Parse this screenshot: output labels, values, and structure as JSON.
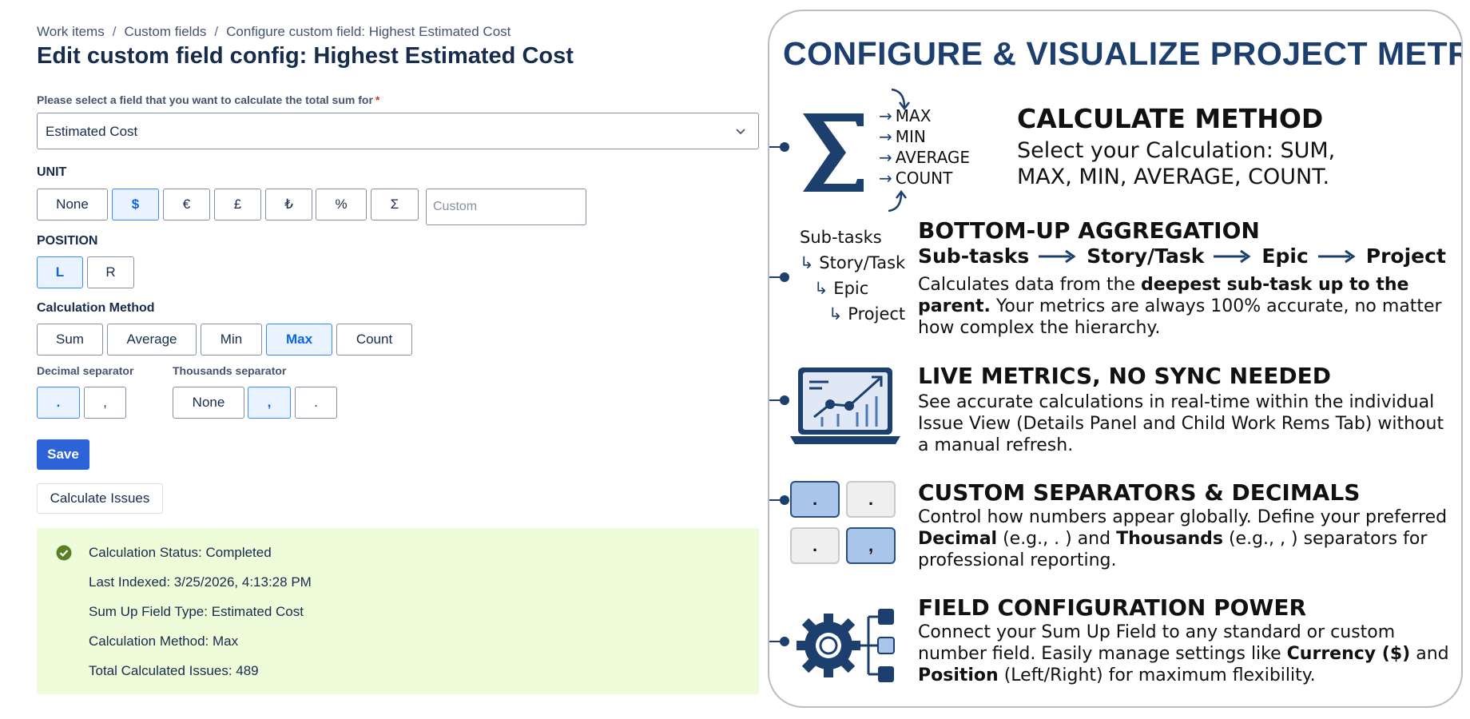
{
  "breadcrumb": [
    "Work items",
    "Custom fields",
    "Configure custom field: Highest Estimated Cost"
  ],
  "breadcrumb_separator": "/",
  "page_title": "Edit custom field config: Highest Estimated Cost",
  "field_select": {
    "label": "Please select a field that you want to calculate the total sum for",
    "required_mark": "*",
    "value": "Estimated Cost"
  },
  "unit": {
    "label": "UNIT",
    "options": [
      "None",
      "$",
      "€",
      "£",
      "₺",
      "%",
      "Σ"
    ],
    "selected": "$",
    "custom_placeholder": "Custom"
  },
  "position": {
    "label": "POSITION",
    "options": [
      "L",
      "R"
    ],
    "selected": "L"
  },
  "calculation_method": {
    "label": "Calculation Method",
    "options": [
      "Sum",
      "Average",
      "Min",
      "Max",
      "Count"
    ],
    "selected": "Max"
  },
  "decimal_separator": {
    "label": "Decimal separator",
    "options": [
      ".",
      ","
    ],
    "selected": "."
  },
  "thousands_separator": {
    "label": "Thousands separator",
    "options": [
      "None",
      ",",
      "."
    ],
    "selected": ","
  },
  "save_label": "Save",
  "calculate_label": "Calculate Issues",
  "status": {
    "lines": [
      "Calculation Status: Completed",
      "Last Indexed: 3/25/2026, 4:13:28 PM",
      "Sum Up Field Type: Estimated Cost",
      "Calculation Method: Max",
      "Total Calculated Issues: 489"
    ],
    "color": "#effcd9",
    "icon": "check-circle-icon"
  },
  "infographic": {
    "title": "CONFIGURE & VISUALIZE PROJECT METRICS",
    "calc_icon_items": [
      "MAX",
      "MIN",
      "AVERAGE",
      "COUNT"
    ],
    "sections": [
      {
        "heading": "CALCULATE METHOD",
        "text1": "Select your Calculation: SUM,",
        "text2": "MAX, MIN, AVERAGE, COUNT."
      },
      {
        "heading": "BOTTOM-UP AGGREGATION",
        "flow": [
          "Sub-tasks",
          "Story/Task",
          "Epic",
          "Project"
        ],
        "tree": [
          "Sub-tasks",
          "Story/Task",
          "Epic",
          "Project"
        ],
        "text_a": "Calculates data from the ",
        "text_b": "deepest sub-task up to the parent.",
        "text_c": "Your metrics are always 100% accurate, no matter how complex the hierarchy."
      },
      {
        "heading": "LIVE METRICS, NO SYNC NEEDED",
        "text": "See accurate calculations in real-time within the individual Issue View (Details Panel and Child Work Rems Tab) without a manual refresh."
      },
      {
        "heading": "CUSTOM SEPARATORS & DECIMALS",
        "boxes": [
          ".",
          ".",
          ".",
          ","
        ],
        "text_a": "Control how numbers appear globally. Define your preferred ",
        "text_b": "Decimal",
        "text_c": " (e.g., . ) and ",
        "text_d": "Thousands",
        "text_e": " (e.g., , ) separators for professional reporting."
      },
      {
        "heading": "FIELD CONFIGURATION POWER",
        "text_a": "Connect your Sum Up Field to any standard or custom number field. Easily manage settings like ",
        "text_b": "Currency ($)",
        "text_c": " and ",
        "text_d": "Position",
        "text_e": " (Left/Right) for maximum flexibility."
      }
    ],
    "accent_color": "#1c3f6e"
  }
}
